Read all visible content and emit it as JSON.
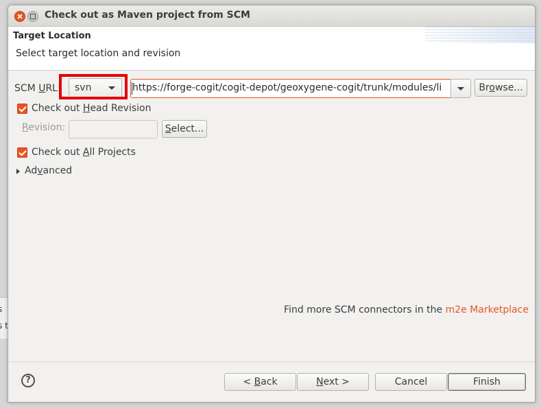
{
  "background": {
    "snippet_1": "s",
    "snippet_2": "s t"
  },
  "window": {
    "title": "Check out as Maven project from SCM"
  },
  "banner": {
    "title": "Target Location",
    "description": "Select target location and revision"
  },
  "scm": {
    "label_pre": "SCM ",
    "label_mnemonic": "U",
    "label_post": "RL:",
    "type_value": "svn",
    "url_value": "https://forge-cogit/cogit-depot/geoxygene-cogit/trunk/modules/li",
    "browse_pre": "Br",
    "browse_mnemonic": "o",
    "browse_post": "wse..."
  },
  "head_revision": {
    "label_pre": "Check out ",
    "label_mnemonic": "H",
    "label_post": "ead Revision",
    "checked": true
  },
  "revision": {
    "label_mnemonic": "R",
    "label_post": "evision:",
    "value": "",
    "select_mnemonic": "S",
    "select_post": "elect..."
  },
  "all_projects": {
    "label_pre": "Check out ",
    "label_mnemonic": "A",
    "label_post": "ll Projects",
    "checked": true
  },
  "advanced": {
    "label_pre": "Ad",
    "label_mnemonic": "v",
    "label_post": "anced"
  },
  "marketplace": {
    "text": "Find more SCM connectors in the ",
    "link": "m2e Marketplace"
  },
  "buttons": {
    "help": "?",
    "back_pre": "< ",
    "back_mnemonic": "B",
    "back_post": "ack",
    "next_pre": "",
    "next_mnemonic": "N",
    "next_post": "ext >",
    "cancel": "Cancel",
    "finish": "Finish"
  },
  "colors": {
    "accent": "#e95420",
    "highlight_box": "#e30000"
  }
}
